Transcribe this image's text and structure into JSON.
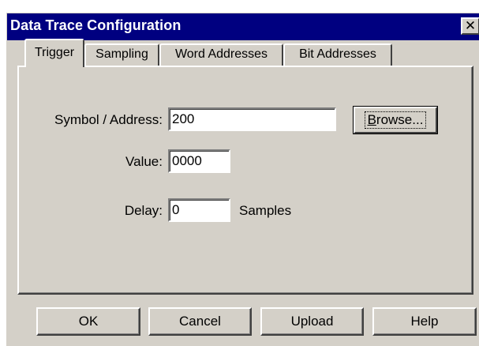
{
  "window": {
    "title": "Data Trace Configuration",
    "close_glyph": "✕"
  },
  "tabs": [
    {
      "label": "Trigger",
      "active": true
    },
    {
      "label": "Sampling",
      "active": false
    },
    {
      "label": "Word Addresses",
      "active": false
    },
    {
      "label": "Bit Addresses",
      "active": false
    }
  ],
  "trigger": {
    "symbol_label": "Symbol / Address:",
    "symbol_value": "200",
    "browse_label_first": "B",
    "browse_label_rest": "rowse...",
    "value_label": "Value:",
    "value_value": "0000",
    "delay_label": "Delay:",
    "delay_value": "0",
    "delay_unit": "Samples"
  },
  "buttons": {
    "ok": "OK",
    "cancel": "Cancel",
    "upload": "Upload",
    "help": "Help"
  }
}
